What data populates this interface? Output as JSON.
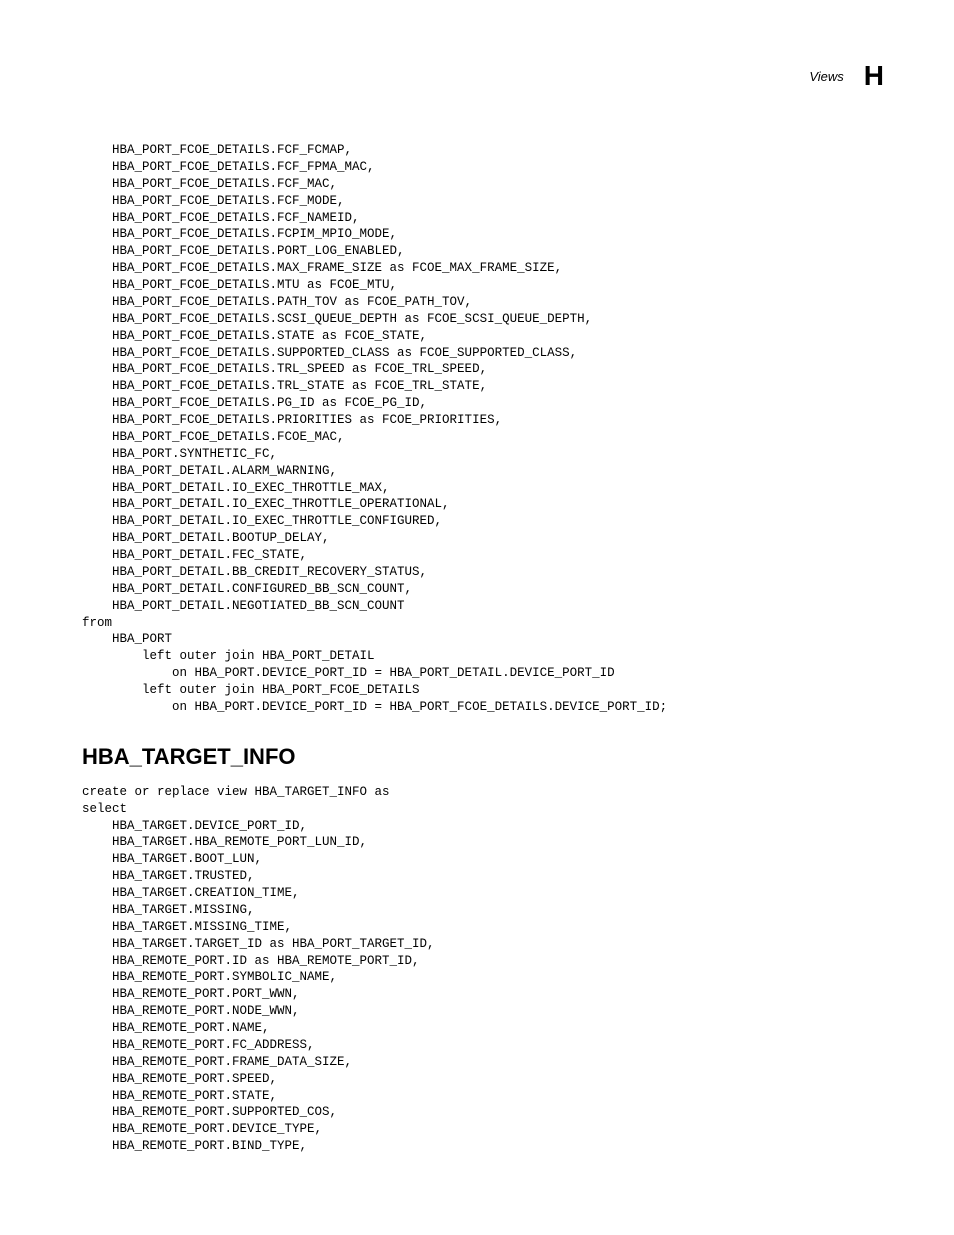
{
  "header": {
    "label": "Views",
    "letter": "H"
  },
  "code1": "    HBA_PORT_FCOE_DETAILS.FCF_FCMAP,\n    HBA_PORT_FCOE_DETAILS.FCF_FPMA_MAC,\n    HBA_PORT_FCOE_DETAILS.FCF_MAC,\n    HBA_PORT_FCOE_DETAILS.FCF_MODE,\n    HBA_PORT_FCOE_DETAILS.FCF_NAMEID,\n    HBA_PORT_FCOE_DETAILS.FCPIM_MPIO_MODE,\n    HBA_PORT_FCOE_DETAILS.PORT_LOG_ENABLED,\n    HBA_PORT_FCOE_DETAILS.MAX_FRAME_SIZE as FCOE_MAX_FRAME_SIZE,\n    HBA_PORT_FCOE_DETAILS.MTU as FCOE_MTU,\n    HBA_PORT_FCOE_DETAILS.PATH_TOV as FCOE_PATH_TOV,\n    HBA_PORT_FCOE_DETAILS.SCSI_QUEUE_DEPTH as FCOE_SCSI_QUEUE_DEPTH,\n    HBA_PORT_FCOE_DETAILS.STATE as FCOE_STATE,\n    HBA_PORT_FCOE_DETAILS.SUPPORTED_CLASS as FCOE_SUPPORTED_CLASS,\n    HBA_PORT_FCOE_DETAILS.TRL_SPEED as FCOE_TRL_SPEED,\n    HBA_PORT_FCOE_DETAILS.TRL_STATE as FCOE_TRL_STATE,\n    HBA_PORT_FCOE_DETAILS.PG_ID as FCOE_PG_ID,\n    HBA_PORT_FCOE_DETAILS.PRIORITIES as FCOE_PRIORITIES,\n    HBA_PORT_FCOE_DETAILS.FCOE_MAC,\n    HBA_PORT.SYNTHETIC_FC,\n    HBA_PORT_DETAIL.ALARM_WARNING,\n    HBA_PORT_DETAIL.IO_EXEC_THROTTLE_MAX,\n    HBA_PORT_DETAIL.IO_EXEC_THROTTLE_OPERATIONAL,\n    HBA_PORT_DETAIL.IO_EXEC_THROTTLE_CONFIGURED,\n    HBA_PORT_DETAIL.BOOTUP_DELAY,\n    HBA_PORT_DETAIL.FEC_STATE,\n    HBA_PORT_DETAIL.BB_CREDIT_RECOVERY_STATUS,\n    HBA_PORT_DETAIL.CONFIGURED_BB_SCN_COUNT,\n    HBA_PORT_DETAIL.NEGOTIATED_BB_SCN_COUNT\nfrom\n    HBA_PORT\n        left outer join HBA_PORT_DETAIL\n            on HBA_PORT.DEVICE_PORT_ID = HBA_PORT_DETAIL.DEVICE_PORT_ID\n        left outer join HBA_PORT_FCOE_DETAILS\n            on HBA_PORT.DEVICE_PORT_ID = HBA_PORT_FCOE_DETAILS.DEVICE_PORT_ID;",
  "heading": "HBA_TARGET_INFO",
  "code2": "create or replace view HBA_TARGET_INFO as\nselect\n    HBA_TARGET.DEVICE_PORT_ID,\n    HBA_TARGET.HBA_REMOTE_PORT_LUN_ID,\n    HBA_TARGET.BOOT_LUN,\n    HBA_TARGET.TRUSTED,\n    HBA_TARGET.CREATION_TIME,\n    HBA_TARGET.MISSING,\n    HBA_TARGET.MISSING_TIME,\n    HBA_TARGET.TARGET_ID as HBA_PORT_TARGET_ID,\n    HBA_REMOTE_PORT.ID as HBA_REMOTE_PORT_ID,\n    HBA_REMOTE_PORT.SYMBOLIC_NAME,\n    HBA_REMOTE_PORT.PORT_WWN,\n    HBA_REMOTE_PORT.NODE_WWN,\n    HBA_REMOTE_PORT.NAME,\n    HBA_REMOTE_PORT.FC_ADDRESS,\n    HBA_REMOTE_PORT.FRAME_DATA_SIZE,\n    HBA_REMOTE_PORT.SPEED,\n    HBA_REMOTE_PORT.STATE,\n    HBA_REMOTE_PORT.SUPPORTED_COS,\n    HBA_REMOTE_PORT.DEVICE_TYPE,\n    HBA_REMOTE_PORT.BIND_TYPE,"
}
